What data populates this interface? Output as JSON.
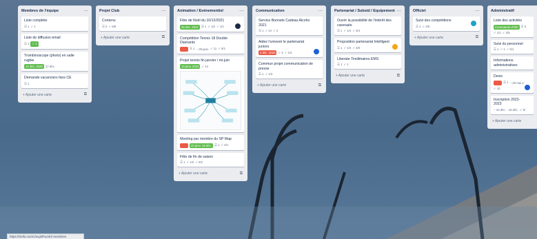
{
  "board": {
    "lists": [
      {
        "title": "Membres de l'équipe",
        "cards": [
          {
            "title": "Liste complète",
            "badges": [
              "☰ 1",
              "✓ 1"
            ]
          },
          {
            "title": "Liste de diffusion email",
            "badges": [
              "☰ 1",
              "✓ 1"
            ]
          },
          {
            "title": "Trombinoscope (photo) en salle rugbie",
            "pill": "12 déc. 2020",
            "pill2": "17 déc."
          },
          {
            "title": "Demande vacanciers fans CE",
            "badges": [
              "☰ 1"
            ]
          }
        ],
        "add_card": "+ Ajouter une carte"
      },
      {
        "title": "Projet Club",
        "cards": [
          {
            "title": "Contenu",
            "badges": [
              "☰ 2",
              "✓ 6/8"
            ]
          }
        ],
        "add_card": "+ Ajouter une carte"
      },
      {
        "title": "Animation / Evénementiel",
        "cards": [
          {
            "title": "Fête de Noël du 10/12/2021",
            "pill": "25 déc. 2021",
            "badges": [
              "☰ 1",
              "✓ 1/2",
              "✓ 1/1"
            ]
          },
          {
            "title": "Compétition Tennis 18 Double Diamants",
            "badges": [
              "☰ 1",
              "◔ 29 janv.",
              "✓ 11",
              "✓ 5/1"
            ]
          },
          {
            "title": "Projet tennis fin janvier / mi-juin",
            "pill": "13 janv. 2022",
            "badges": [
              "✓ 14"
            ]
          },
          {
            "title": "Meeting par membre du SP Map",
            "pill": "22 janv. 18 déc.",
            "badges": [
              "☰ 1",
              "✓ 0/1"
            ]
          },
          {
            "title": "Fête de fin de saison",
            "badges": [
              "☰ 1",
              "✓ 1/2",
              "✓ 0/2"
            ]
          }
        ],
        "add_card": "+ Ajouter une carte"
      },
      {
        "title": "Communication",
        "cards": [
          {
            "title": "Service Bonnets Cadeau Alcoho 2021",
            "badges": [
              "☰ 1",
              "✓ 14",
              "✓ 2"
            ]
          },
          {
            "title": "Aidez l'univesir le partenariat juniors",
            "pill": "3 déc. 2020",
            "badges": [
              "✓ 3",
              "✓ 1/3"
            ]
          },
          {
            "title": "Commun projet communication de presse",
            "badges": [
              "☰ 1",
              "✓ 1/3"
            ]
          }
        ],
        "add_card": "+ Ajouter une carte"
      },
      {
        "title": "Partenariat / Subsid / Equipement",
        "cards": [
          {
            "title": "Ouvrir la possibilité de l'intérêt des carenaée",
            "badges": [
              "☰ 1",
              "✓ 1/4",
              "✓ 3/4"
            ]
          },
          {
            "title": "Proposition partenariat Intelligent",
            "badges": [
              "☰ 1",
              "✓ 1/4",
              "✓ 2/8"
            ]
          },
          {
            "title": "Liberate Tonilimaires EMS",
            "badges": [
              "☰ 1",
              "✓ 1"
            ]
          }
        ],
        "add_card": "+ Ajouter une carte"
      },
      {
        "title": "Officiel",
        "cards": [
          {
            "title": "Suivi des compétitions",
            "badges": [
              "☰ 1",
              "✓ 2/5"
            ]
          }
        ],
        "add_card": "+ Ajouter une carte"
      },
      {
        "title": "Administratif",
        "cards": [
          {
            "title": "Liste des activités",
            "pill": "Commande d'info",
            "badges": [
              "☰ 3",
              "✓ 1/1",
              "✓ 2/5"
            ]
          },
          {
            "title": "Suivi du personnel",
            "badges": [
              "☰ 1",
              "✓ 1",
              "✓ 5/1"
            ]
          },
          {
            "title": "Informations administratives",
            "badges": []
          },
          {
            "title": "Devis",
            "badges": [
              "☰ 1",
              "◔ 28 mai 2",
              "✓ 10"
            ]
          },
          {
            "title": "Inscription 2022-2023",
            "badges": [
              "◔ 10 déc. - 16 déc.",
              "✓ 5/"
            ]
          }
        ],
        "add_card": "+ Ajouter une carte"
      }
    ]
  },
  "status_bar": {
    "text": "https://trello.com/c/eqJdFwJ4/2-membres"
  },
  "icons": {
    "list_menu": "ellipsis-icon",
    "card_template": "template-icon",
    "description": "description-icon",
    "checklist": "checklist-icon",
    "due": "clock-icon"
  },
  "colors": {
    "label_green": "#61bd4f",
    "label_red": "#eb5a46",
    "list_bg": "#ebecf0"
  }
}
